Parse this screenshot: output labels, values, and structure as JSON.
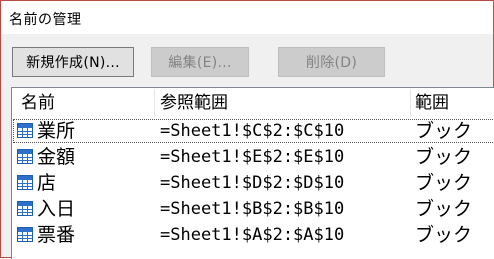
{
  "dialog": {
    "title": "名前の管理"
  },
  "toolbar": {
    "new_label": "新規作成(N)...",
    "edit_label": "編集(E)...",
    "delete_label": "削除(D)"
  },
  "columns": {
    "name": "名前",
    "refers_to": "参照範囲",
    "scope": "範囲"
  },
  "names": [
    {
      "name": "業所",
      "refers_to": "=Sheet1!$C$2:$C$10",
      "scope": "ブック"
    },
    {
      "name": "金額",
      "refers_to": "=Sheet1!$E$2:$E$10",
      "scope": "ブック"
    },
    {
      "name": "店",
      "refers_to": "=Sheet1!$D$2:$D$10",
      "scope": "ブック"
    },
    {
      "name": "入日",
      "refers_to": "=Sheet1!$B$2:$B$10",
      "scope": "ブック"
    },
    {
      "name": "票番",
      "refers_to": "=Sheet1!$A$2:$A$10",
      "scope": "ブック"
    }
  ],
  "colors": {
    "window_border": "#c0504d",
    "icon_blue": "#2e6fc9"
  }
}
